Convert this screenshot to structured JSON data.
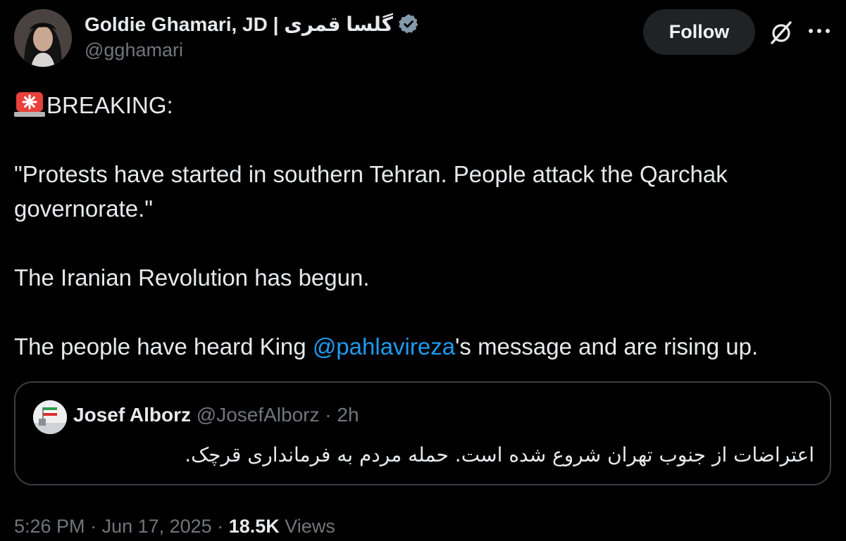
{
  "author": {
    "display_name": "Goldie Ghamari, JD | گلسا قمری",
    "handle": "@gghamari",
    "verified": true
  },
  "actions": {
    "follow_label": "Follow"
  },
  "tweet": {
    "breaking": "BREAKING:",
    "quote_line": "\"Protests have started in southern Tehran. People attack the Qarchak governorate.\"",
    "revolution_line": "The Iranian Revolution has begun.",
    "king_prefix": "The people have heard King ",
    "mention": "@pahlavireza",
    "king_suffix": "'s message and are rising up."
  },
  "quoted_tweet": {
    "name": "Josef Alborz",
    "handle": "@JosefAlborz",
    "separator": " · ",
    "time": "2h",
    "text": "اعتراضات از جنوب تهران شروع شده است. حمله مردم به فرمانداری قرچک."
  },
  "footer": {
    "time": "5:26 PM",
    "date": "Jun 17, 2025",
    "separator": " · ",
    "views_count": "18.5K",
    "views_label": "Views"
  },
  "icons": {
    "verified": "verified-badge-icon",
    "grok": "grok-icon",
    "more": "more-icon",
    "siren": "siren-emoji-icon"
  },
  "colors": {
    "background": "#000000",
    "text": "#e7e9ea",
    "muted": "#71767b",
    "link": "#1d9bf0",
    "border": "#3a3d40",
    "follow_bg": "#1f2326"
  }
}
